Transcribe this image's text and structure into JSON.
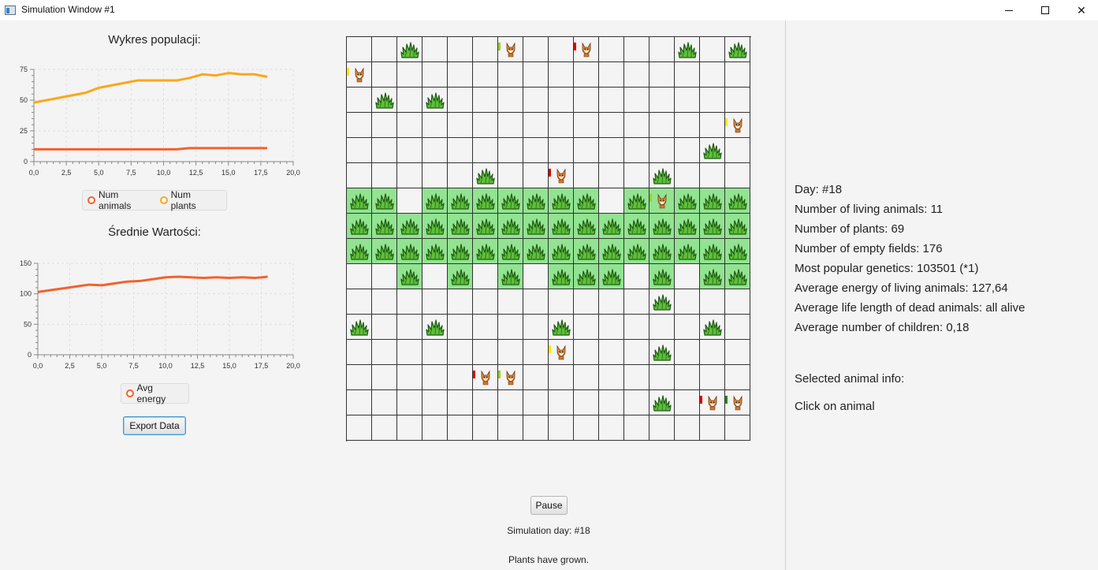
{
  "window": {
    "title": "Simulation Window #1"
  },
  "population_chart": {
    "title": "Wykres populacji:",
    "legend": [
      {
        "label": "Num animals",
        "color": "#f3622d"
      },
      {
        "label": "Num plants",
        "color": "#fba71b"
      }
    ]
  },
  "energy_chart": {
    "title": "Średnie Wartości:",
    "legend": [
      {
        "label": "Avg energy",
        "color": "#f3622d"
      }
    ]
  },
  "chart_data": [
    {
      "type": "line",
      "title": "Wykres populacji:",
      "x": [
        0,
        1,
        2,
        3,
        4,
        5,
        6,
        7,
        8,
        9,
        10,
        11,
        12,
        13,
        14,
        15,
        16,
        17,
        18
      ],
      "series": [
        {
          "name": "Num animals",
          "color": "#f3622d",
          "values": [
            10,
            10,
            10,
            10,
            10,
            10,
            10,
            10,
            10,
            10,
            10,
            10,
            11,
            11,
            11,
            11,
            11,
            11,
            11
          ]
        },
        {
          "name": "Num plants",
          "color": "#fba71b",
          "values": [
            48,
            50,
            52,
            54,
            56,
            60,
            62,
            64,
            66,
            66,
            66,
            66,
            68,
            71,
            70,
            72,
            71,
            71,
            69
          ]
        }
      ],
      "xlim": [
        0,
        20
      ],
      "ylim": [
        0,
        75
      ],
      "xticks": [
        "0,0",
        "2,5",
        "5,0",
        "7,5",
        "10,0",
        "12,5",
        "15,0",
        "17,5",
        "20,0"
      ],
      "yticks": [
        "0",
        "25",
        "50",
        "75"
      ],
      "grid": true,
      "legend": "bottom"
    },
    {
      "type": "line",
      "title": "Średnie Wartości:",
      "x": [
        0,
        1,
        2,
        3,
        4,
        5,
        6,
        7,
        8,
        9,
        10,
        11,
        12,
        13,
        14,
        15,
        16,
        17,
        18
      ],
      "series": [
        {
          "name": "Avg energy",
          "color": "#f3622d",
          "values": [
            103,
            106,
            109,
            112,
            115,
            114,
            117,
            120,
            121,
            124,
            127,
            128,
            127,
            126,
            127,
            126,
            127,
            126,
            128
          ]
        }
      ],
      "xlim": [
        0,
        20
      ],
      "ylim": [
        0,
        150
      ],
      "xticks": [
        "0,0",
        "2,5",
        "5,0",
        "7,5",
        "10,0",
        "12,5",
        "15,0",
        "17,5",
        "20,0"
      ],
      "yticks": [
        "0",
        "50",
        "100",
        "150"
      ],
      "grid": true,
      "legend": "bottom"
    }
  ],
  "export_button": "Export Data",
  "grid_map": {
    "jungle_cells": [
      [
        6,
        0
      ],
      [
        6,
        1
      ],
      [
        6,
        3
      ],
      [
        6,
        4
      ],
      [
        6,
        5
      ],
      [
        6,
        6
      ],
      [
        6,
        7
      ],
      [
        6,
        8
      ],
      [
        6,
        9
      ],
      [
        6,
        11
      ],
      [
        6,
        12
      ],
      [
        6,
        13
      ],
      [
        6,
        14
      ],
      [
        6,
        15
      ],
      [
        7,
        0
      ],
      [
        7,
        1
      ],
      [
        7,
        2
      ],
      [
        7,
        3
      ],
      [
        7,
        4
      ],
      [
        7,
        5
      ],
      [
        7,
        6
      ],
      [
        7,
        7
      ],
      [
        7,
        8
      ],
      [
        7,
        9
      ],
      [
        7,
        10
      ],
      [
        7,
        11
      ],
      [
        7,
        12
      ],
      [
        7,
        13
      ],
      [
        7,
        14
      ],
      [
        7,
        15
      ],
      [
        8,
        0
      ],
      [
        8,
        1
      ],
      [
        8,
        2
      ],
      [
        8,
        3
      ],
      [
        8,
        4
      ],
      [
        8,
        5
      ],
      [
        8,
        6
      ],
      [
        8,
        7
      ],
      [
        8,
        8
      ],
      [
        8,
        9
      ],
      [
        8,
        10
      ],
      [
        8,
        11
      ],
      [
        8,
        12
      ],
      [
        8,
        13
      ],
      [
        8,
        14
      ],
      [
        8,
        15
      ],
      [
        9,
        2
      ],
      [
        9,
        4
      ],
      [
        9,
        6
      ],
      [
        9,
        8
      ],
      [
        9,
        9
      ],
      [
        9,
        10
      ],
      [
        9,
        12
      ],
      [
        9,
        14
      ],
      [
        9,
        15
      ]
    ],
    "plant_cells": [
      [
        0,
        2
      ],
      [
        0,
        13
      ],
      [
        0,
        15
      ],
      [
        2,
        1
      ],
      [
        2,
        3
      ],
      [
        4,
        14
      ],
      [
        5,
        5
      ],
      [
        5,
        12
      ],
      [
        6,
        0
      ],
      [
        6,
        1
      ],
      [
        6,
        3
      ],
      [
        6,
        4
      ],
      [
        6,
        5
      ],
      [
        6,
        6
      ],
      [
        6,
        7
      ],
      [
        6,
        8
      ],
      [
        6,
        9
      ],
      [
        6,
        11
      ],
      [
        6,
        13
      ],
      [
        6,
        14
      ],
      [
        6,
        15
      ],
      [
        7,
        0
      ],
      [
        7,
        1
      ],
      [
        7,
        2
      ],
      [
        7,
        3
      ],
      [
        7,
        4
      ],
      [
        7,
        5
      ],
      [
        7,
        6
      ],
      [
        7,
        7
      ],
      [
        7,
        8
      ],
      [
        7,
        9
      ],
      [
        7,
        10
      ],
      [
        7,
        11
      ],
      [
        7,
        12
      ],
      [
        7,
        13
      ],
      [
        7,
        14
      ],
      [
        7,
        15
      ],
      [
        8,
        0
      ],
      [
        8,
        1
      ],
      [
        8,
        2
      ],
      [
        8,
        3
      ],
      [
        8,
        4
      ],
      [
        8,
        5
      ],
      [
        8,
        6
      ],
      [
        8,
        7
      ],
      [
        8,
        8
      ],
      [
        8,
        9
      ],
      [
        8,
        10
      ],
      [
        8,
        11
      ],
      [
        8,
        12
      ],
      [
        8,
        13
      ],
      [
        8,
        14
      ],
      [
        8,
        15
      ],
      [
        9,
        2
      ],
      [
        9,
        4
      ],
      [
        9,
        6
      ],
      [
        9,
        8
      ],
      [
        9,
        9
      ],
      [
        9,
        10
      ],
      [
        9,
        12
      ],
      [
        9,
        14
      ],
      [
        9,
        15
      ],
      [
        10,
        12
      ],
      [
        11,
        0
      ],
      [
        11,
        3
      ],
      [
        11,
        8
      ],
      [
        11,
        14
      ],
      [
        12,
        12
      ],
      [
        14,
        12
      ]
    ],
    "animals": [
      {
        "cell": [
          0,
          6
        ],
        "energy_color": "#9acd32"
      },
      {
        "cell": [
          0,
          9
        ],
        "energy_color": "#e00000"
      },
      {
        "cell": [
          1,
          0
        ],
        "energy_color": "#ffe600"
      },
      {
        "cell": [
          3,
          15
        ],
        "energy_color": "#ffe600"
      },
      {
        "cell": [
          5,
          8
        ],
        "energy_color": "#e00000"
      },
      {
        "cell": [
          6,
          12
        ],
        "energy_color": "#9acd32"
      },
      {
        "cell": [
          12,
          8
        ],
        "energy_color": "#ffe600"
      },
      {
        "cell": [
          13,
          5
        ],
        "energy_color": "#e00000"
      },
      {
        "cell": [
          13,
          6
        ],
        "energy_color": "#9acd32"
      },
      {
        "cell": [
          14,
          14
        ],
        "energy_color": "#e00000"
      },
      {
        "cell": [
          14,
          15
        ],
        "energy_color": "#1a8a1a"
      }
    ]
  },
  "controls": {
    "pause_label": "Pause",
    "simulation_day": "Simulation day: #18",
    "status_message": "Plants have grown."
  },
  "stats": {
    "day": "Day: #18",
    "living_animals": "Number of living animals: 11",
    "plants": "Number of plants: 69",
    "empty_fields": "Number of empty fields: 176",
    "popular_genetics": "Most popular genetics: 103501 (*1)",
    "avg_energy": "Average energy of living animals: 127,64",
    "avg_life_length": "Average life length of dead animals: all alive",
    "avg_children": "Average number of children: 0,18",
    "selected_header": "Selected animal info:",
    "selected_hint": "Click on animal"
  }
}
